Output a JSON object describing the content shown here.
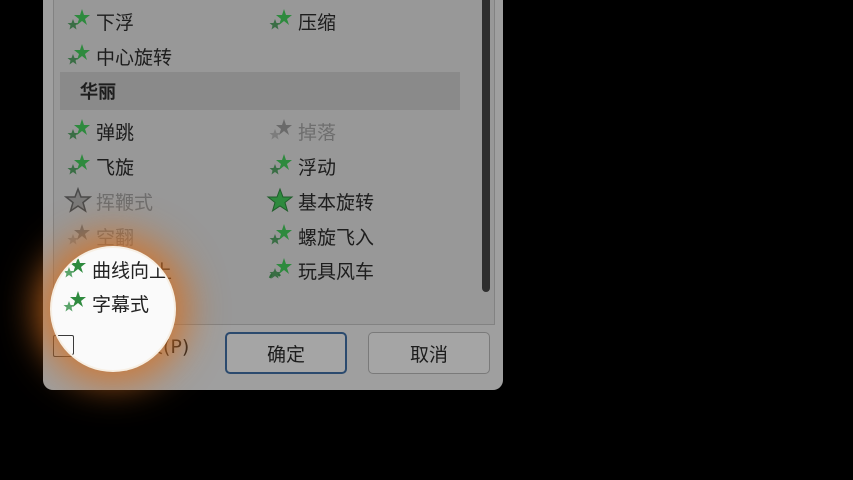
{
  "effects_list": {
    "row0": {
      "left": "下浮",
      "right": "压缩"
    },
    "row1": {
      "left": "中心旋转"
    },
    "group_header": "华丽",
    "items_left": [
      "弹跳",
      "飞旋",
      "挥鞭式",
      "空翻",
      "曲线向上",
      "字幕式"
    ],
    "items_right": [
      "掉落",
      "浮动",
      "基本旋转",
      "螺旋飞入",
      "玩具风车"
    ]
  },
  "footer": {
    "preview_label": "预览效果(P)",
    "ok_label": "确定",
    "cancel_label": "取消"
  },
  "colors": {
    "star_green": "#2e8a3e",
    "highlight_glow": "#d67020"
  }
}
